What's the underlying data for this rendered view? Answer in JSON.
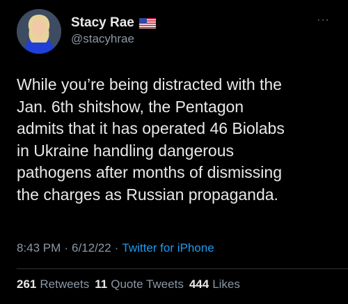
{
  "author": {
    "name": "Stacy Rae",
    "handle": "@stacyhrae",
    "flag_icon": "us-flag-icon",
    "more_label": "···"
  },
  "tweet": {
    "lines": [
      "While you’re being distracted with the",
      "Jan. 6th shitshow, the Pentagon",
      "admits that it has operated 46 Biolabs",
      "in Ukraine handling dangerous",
      "pathogens after months of dismissing",
      "the charges as Russian propaganda."
    ]
  },
  "meta": {
    "time": "8:43 PM",
    "sep1": "·",
    "date": "6/12/22",
    "sep2": "·",
    "source": "Twitter for iPhone"
  },
  "stats": {
    "retweets_count": "261",
    "retweets_label": "Retweets",
    "quotes_count": "11",
    "quotes_label": "Quote Tweets",
    "likes_count": "444",
    "likes_label": "Likes"
  },
  "colors": {
    "background": "#000000",
    "text": "#e7e9ea",
    "secondary": "#8b98a5",
    "link": "#1d9bf0",
    "divider": "#2f3336"
  }
}
